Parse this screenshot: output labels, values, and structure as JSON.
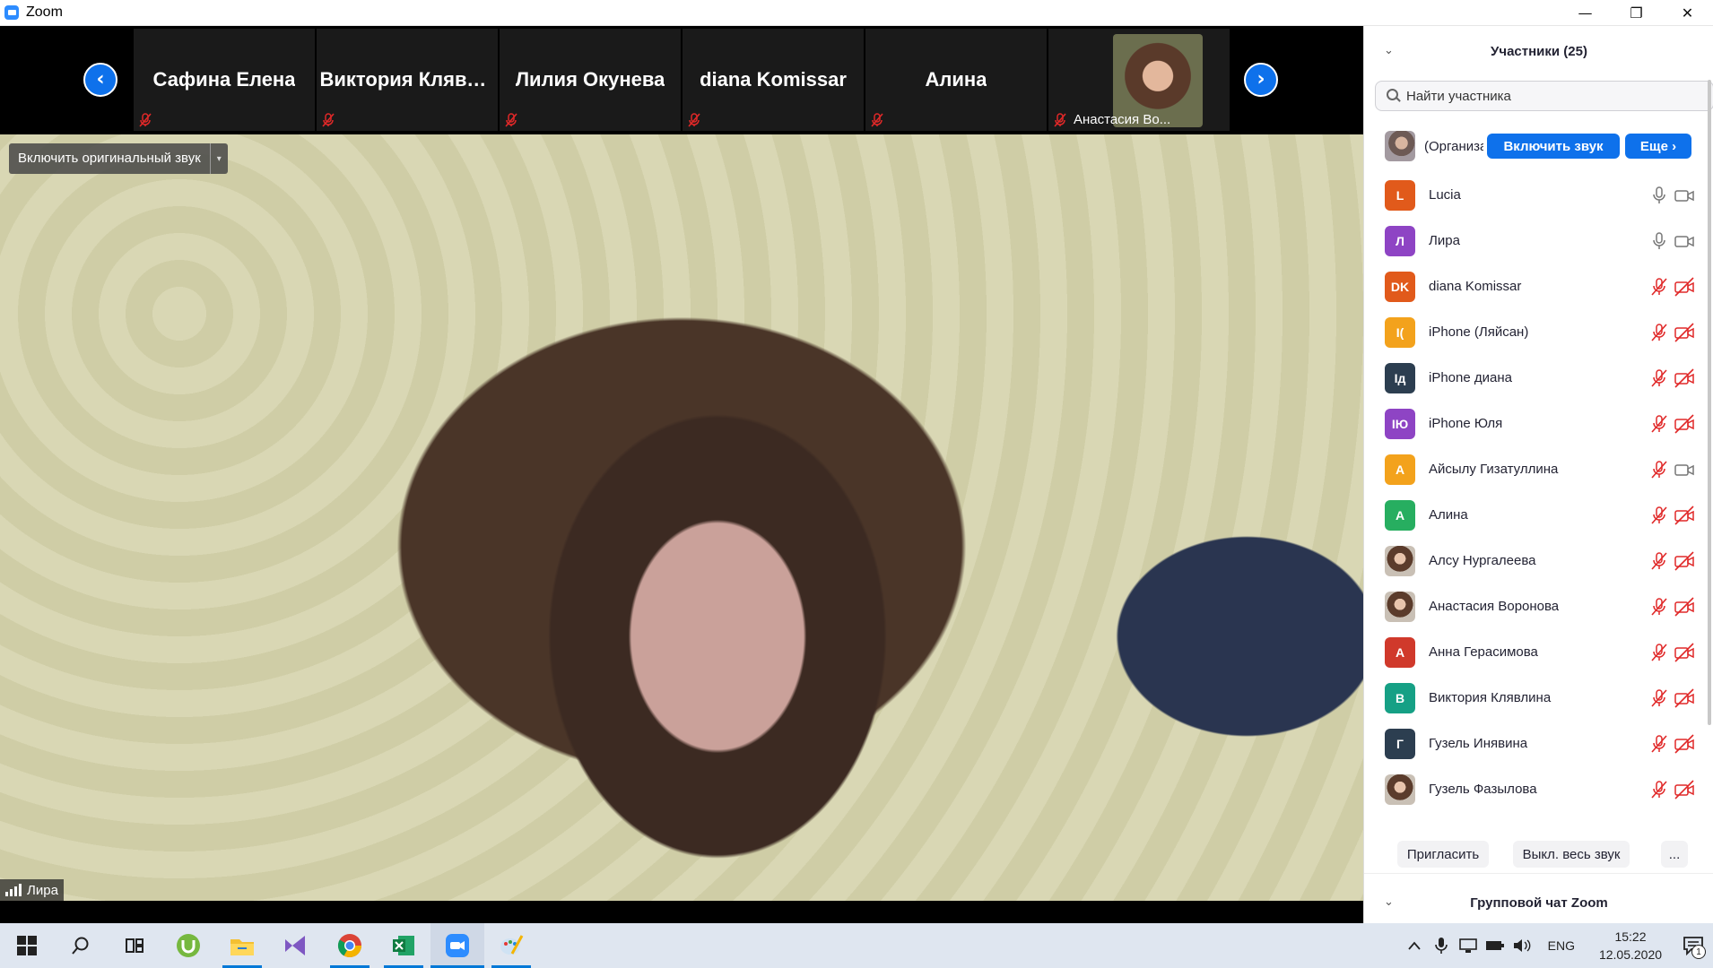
{
  "window": {
    "title": "Zoom",
    "minimize": "—",
    "restore": "❐",
    "close": "✕"
  },
  "strip": {
    "prev_icon": "‹",
    "next_icon": "›",
    "tiles": [
      {
        "name": "Сафина Елена"
      },
      {
        "name": "Виктория Клявлина"
      },
      {
        "name": "Лилия Окунева"
      },
      {
        "name": "diana Komissar"
      },
      {
        "name": "Алина"
      },
      {
        "name": "Анастасия Воронова",
        "short": "Анастасия Во..."
      }
    ]
  },
  "video": {
    "original_sound_label": "Включить оригинальный звук",
    "dropdown_icon": "▾",
    "speaker_name": "Лира"
  },
  "panel": {
    "title": "Участники (25)",
    "collapse_icon": "⌄",
    "search_placeholder": "Найти участника",
    "host": {
      "name": "(Организатор)",
      "unmute_label": "Включить звук",
      "more_label": "Еще ›"
    },
    "participants": [
      {
        "name": "Lucia",
        "initials": "L",
        "color": "#e15a1b",
        "mic": "on",
        "cam": "on"
      },
      {
        "name": "Лира",
        "initials": "Л",
        "color": "#8e44c4",
        "mic": "on",
        "cam": "on"
      },
      {
        "name": "diana Komissar",
        "initials": "DK",
        "color": "#e15a1b",
        "mic": "off",
        "cam": "off"
      },
      {
        "name": "iPhone (Ляйсан)",
        "initials": "I(",
        "color": "#f3a21c",
        "mic": "off",
        "cam": "off"
      },
      {
        "name": "iPhone диана",
        "initials": "Iд",
        "color": "#2c3e50",
        "mic": "off",
        "cam": "off"
      },
      {
        "name": "iPhone Юля",
        "initials": "IЮ",
        "color": "#8e44c4",
        "mic": "off",
        "cam": "off"
      },
      {
        "name": "Айсылу Гизатуллина",
        "initials": "А",
        "color": "#f3a21c",
        "mic": "off",
        "cam": "on"
      },
      {
        "name": "Алина",
        "initials": "А",
        "color": "#27ae60",
        "mic": "off",
        "cam": "off"
      },
      {
        "name": "Алсу Нургалеева",
        "initials": "",
        "color": "",
        "photo": true,
        "mic": "off",
        "cam": "off"
      },
      {
        "name": "Анастасия Воронова",
        "initials": "",
        "color": "",
        "photo": true,
        "mic": "off",
        "cam": "off"
      },
      {
        "name": "Анна Герасимова",
        "initials": "А",
        "color": "#d0392b",
        "mic": "off",
        "cam": "off"
      },
      {
        "name": "Виктория Клявлина",
        "initials": "В",
        "color": "#16a085",
        "mic": "off",
        "cam": "off"
      },
      {
        "name": "Гузель Инявина",
        "initials": "Г",
        "color": "#2c3e50",
        "mic": "off",
        "cam": "off"
      },
      {
        "name": "Гузель Фазылова",
        "initials": "",
        "color": "",
        "photo": true,
        "mic": "off",
        "cam": "off"
      }
    ],
    "invite_label": "Пригласить",
    "mute_all_label": "Выкл. весь звук",
    "more_dots": "...",
    "chat_title": "Групповой чат Zoom"
  },
  "taskbar": {
    "lang": "ENG",
    "time": "15:22",
    "date": "12.05.2020",
    "notifications": "1"
  },
  "colors": {
    "accent": "#0e71eb",
    "mute_red": "#e02828"
  }
}
